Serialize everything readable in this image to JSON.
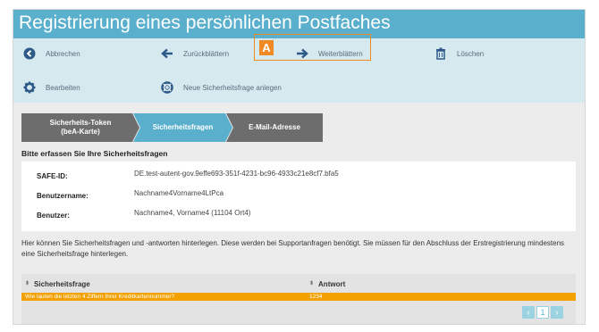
{
  "window": {
    "title": "Registrierung eines persönlichen Postfaches"
  },
  "toolbar": {
    "cancel_label": "Abbrechen",
    "back_label": "Zurückblättern",
    "forward_label": "Weiterblättern",
    "delete_label": "Löschen",
    "edit_label": "Bearbeiten",
    "new_question_label": "Neue Sicherheitsfrage anlegen",
    "badge": "A"
  },
  "steps": [
    {
      "label": "Sicherheits-Token\n(beA-Karte)",
      "state": "done"
    },
    {
      "label": "Sicherheitsfragen",
      "state": "active"
    },
    {
      "label": "E-Mail-Adresse",
      "state": "pending"
    }
  ],
  "section": {
    "title": "Bitte erfassen Sie Ihre Sicherheitsfragen"
  },
  "info": {
    "safe_id_label": "SAFE-ID:",
    "safe_id_value": "DE.test-autent-gov.9effe693-351f-4231-bc96-4933c21e8cf7.bfa5",
    "username_label": "Benutzername:",
    "username_value": "Nachname4Vorname4LtPca",
    "user_label": "Benutzer:",
    "user_value": "Nachname4, Vorname4 (11104 Ort4)"
  },
  "description": "Hier können Sie Sicherheitsfragen und -antworten hinterlegen. Diese werden bei Supportanfragen benötigt. Sie müssen für den Abschluss der Erstregistrierung mindestens eine Sicherheitsfrage hinterlegen.",
  "grid": {
    "col_question": "Sicherheitsfrage",
    "col_answer": "Antwort",
    "rows": [
      {
        "question": "Wie lauten die letzten 4 Ziffern Ihrer Kreditkartennummer?",
        "answer": "1234"
      }
    ]
  },
  "pager": {
    "current": "1",
    "prev": "‹",
    "next": "›"
  },
  "colors": {
    "header": "#5ab0cc",
    "toolbar": "#d5e9ef",
    "highlight": "#f08a24",
    "selected_row": "#f2a100",
    "step_inactive": "#6d6d6d"
  }
}
